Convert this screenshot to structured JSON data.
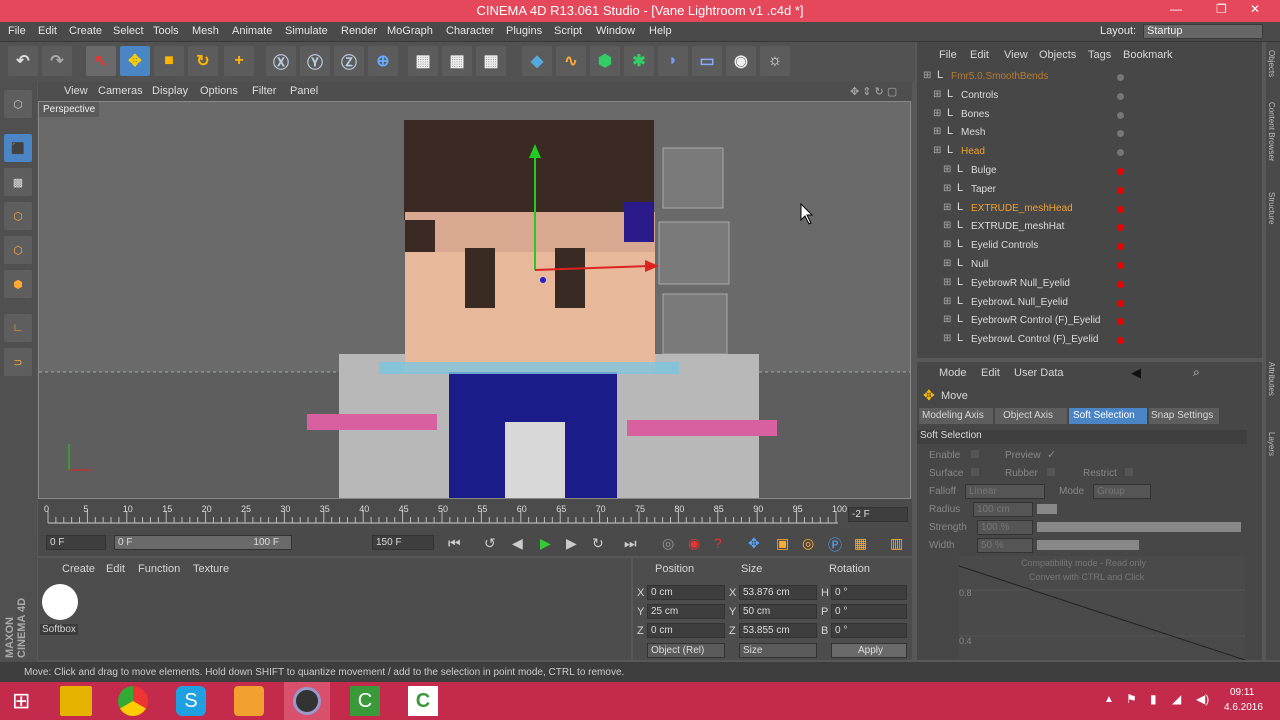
{
  "window": {
    "title": "CINEMA 4D R13.061 Studio - [Vane Lightroom v1 .c4d *]",
    "controls": [
      "—",
      "❐",
      "✕"
    ]
  },
  "menu": [
    "File",
    "Edit",
    "Create",
    "Select",
    "Tools",
    "Mesh",
    "Animate",
    "Simulate",
    "Render",
    "MoGraph",
    "Character",
    "Plugins",
    "Script",
    "Window",
    "Help"
  ],
  "layout": {
    "label": "Layout:",
    "value": "Startup"
  },
  "viewport": {
    "menu": [
      "View",
      "Cameras",
      "Display",
      "Options",
      "Filter",
      "Panel"
    ],
    "label": "Perspective"
  },
  "timeline": {
    "ticks": [
      "0",
      "5",
      "10",
      "15",
      "20",
      "25",
      "30",
      "35",
      "40",
      "45",
      "50",
      "55",
      "60",
      "65",
      "70",
      "75",
      "80",
      "85",
      "90",
      "95",
      "100"
    ],
    "end_frame": "-2 F",
    "current": "0 F",
    "range_start": "0 F",
    "range_end": "100 F",
    "max": "150 F"
  },
  "material_manager": {
    "menu": [
      "Create",
      "Edit",
      "Function",
      "Texture"
    ],
    "material": "Softbox"
  },
  "coordinates": {
    "headers": [
      "Position",
      "Size",
      "Rotation"
    ],
    "rows": [
      {
        "axis": "X",
        "pos": "0 cm",
        "size_axis": "X",
        "size": "53.876 cm",
        "rot_axis": "H",
        "rot": "0 °"
      },
      {
        "axis": "Y",
        "pos": "25 cm",
        "size_axis": "Y",
        "size": "50 cm",
        "rot_axis": "P",
        "rot": "0 °"
      },
      {
        "axis": "Z",
        "pos": "0 cm",
        "size_axis": "Z",
        "size": "53.855 cm",
        "rot_axis": "B",
        "rot": "0 °"
      }
    ],
    "mode": "Object (Rel)",
    "size_mode": "Size",
    "apply": "Apply"
  },
  "object_manager": {
    "menu": [
      "File",
      "Edit",
      "View",
      "Objects",
      "Tags",
      "Bookmark"
    ],
    "items": [
      {
        "name": "Fmr5.0.SmoothBends",
        "level": 0,
        "color": "orange",
        "dim": true
      },
      {
        "name": "Controls",
        "level": 1,
        "color": "normal"
      },
      {
        "name": "Bones",
        "level": 1,
        "color": "normal"
      },
      {
        "name": "Mesh",
        "level": 1,
        "color": "normal"
      },
      {
        "name": "Head",
        "level": 1,
        "color": "orange"
      },
      {
        "name": "Bulge",
        "level": 2,
        "color": "normal"
      },
      {
        "name": "Taper",
        "level": 2,
        "color": "normal"
      },
      {
        "name": "EXTRUDE_meshHead",
        "level": 2,
        "color": "orange"
      },
      {
        "name": "EXTRUDE_meshHat",
        "level": 2,
        "color": "normal"
      },
      {
        "name": "Eyelid Controls",
        "level": 2,
        "color": "normal"
      },
      {
        "name": "Null",
        "level": 2,
        "color": "normal"
      },
      {
        "name": "EyebrowR Null_Eyelid",
        "level": 2,
        "color": "normal"
      },
      {
        "name": "EyebrowL Null_Eyelid",
        "level": 2,
        "color": "normal"
      },
      {
        "name": "EyebrowR Control (F)_Eyelid",
        "level": 2,
        "color": "normal"
      },
      {
        "name": "EyebrowL Control (F)_Eyelid",
        "level": 2,
        "color": "normal"
      }
    ]
  },
  "attribute_manager": {
    "menu": [
      "Mode",
      "Edit",
      "User Data"
    ],
    "tool": "Move",
    "tabs": [
      "Modeling Axis",
      "Object Axis",
      "Soft Selection",
      "Snap Settings"
    ],
    "active_tab": "Soft Selection",
    "section": "Soft Selection",
    "fields": {
      "enable": "Enable",
      "preview": "Preview",
      "surface": "Surface",
      "rubber": "Rubber",
      "restrict": "Restrict",
      "falloff_label": "Falloff",
      "falloff": "Linear",
      "mode_label": "Mode",
      "mode": "Group",
      "radius_label": "Radius",
      "radius": "100 cm",
      "strength_label": "Strength",
      "strength": "100 %",
      "width_label": "Width",
      "width": "50 %"
    },
    "graph_note_1": "Compatibility mode - Read only",
    "graph_note_2": "Convert with CTRL and Click",
    "graph_y": [
      "0.8",
      "0.4"
    ]
  },
  "status": "Move: Click and drag to move elements. Hold down SHIFT to quantize movement / add to the selection in point mode, CTRL to remove.",
  "side_tabs": [
    "Objects",
    "Content Browser",
    "Structure",
    "Attributes",
    "Layers"
  ],
  "brand": "MAXON CINEMA 4D",
  "taskbar": {
    "time": "09:11",
    "date": "4.6.2016"
  }
}
